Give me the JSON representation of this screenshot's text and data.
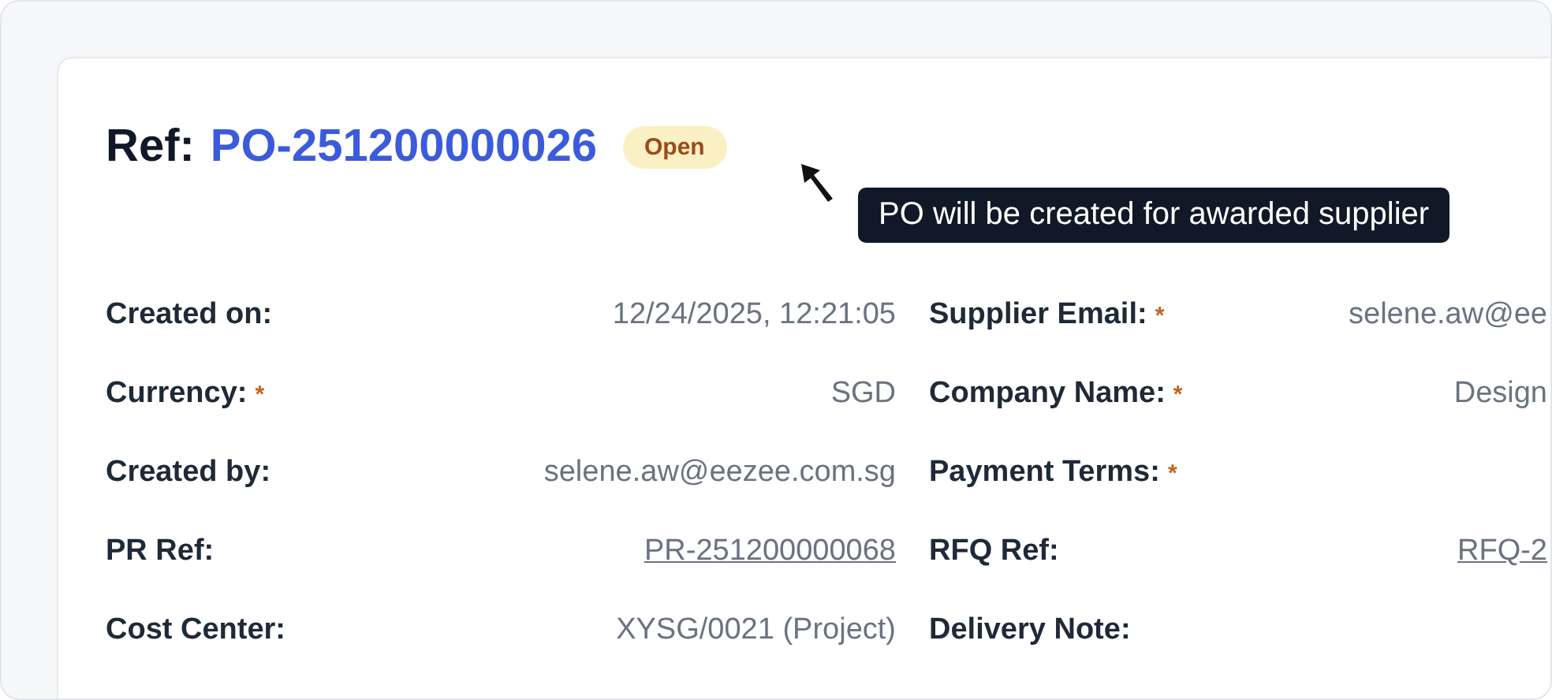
{
  "header": {
    "label": "Ref:",
    "ref": "PO-251200000026",
    "status": "Open"
  },
  "tooltip": "PO will be created for awarded supplier",
  "fields": [
    {
      "label": "Created on:",
      "kind": "text",
      "value": "12/24/2025, 12:21:05"
    },
    {
      "label": "Supplier Email:",
      "required_mark": "*",
      "kind": "text",
      "value": "selene.aw@ee"
    },
    {
      "label": "Currency:",
      "required_mark": "*",
      "kind": "text",
      "value": "SGD"
    },
    {
      "label": "Company Name:",
      "required_mark": "*",
      "kind": "text",
      "value": "Design"
    },
    {
      "label": "Created by:",
      "kind": "text",
      "value": "selene.aw@eezee.com.sg"
    },
    {
      "label": "Payment Terms:",
      "required_mark": "*"
    },
    {
      "label": "PR Ref:",
      "kind": "link",
      "value": "PR-251200000068"
    },
    {
      "label": "RFQ Ref:",
      "kind": "link",
      "value": "RFQ-2"
    },
    {
      "label": "Cost Center:",
      "kind": "text",
      "value": "XYSG/0021 (Project)"
    },
    {
      "label": "Delivery Note:"
    }
  ]
}
